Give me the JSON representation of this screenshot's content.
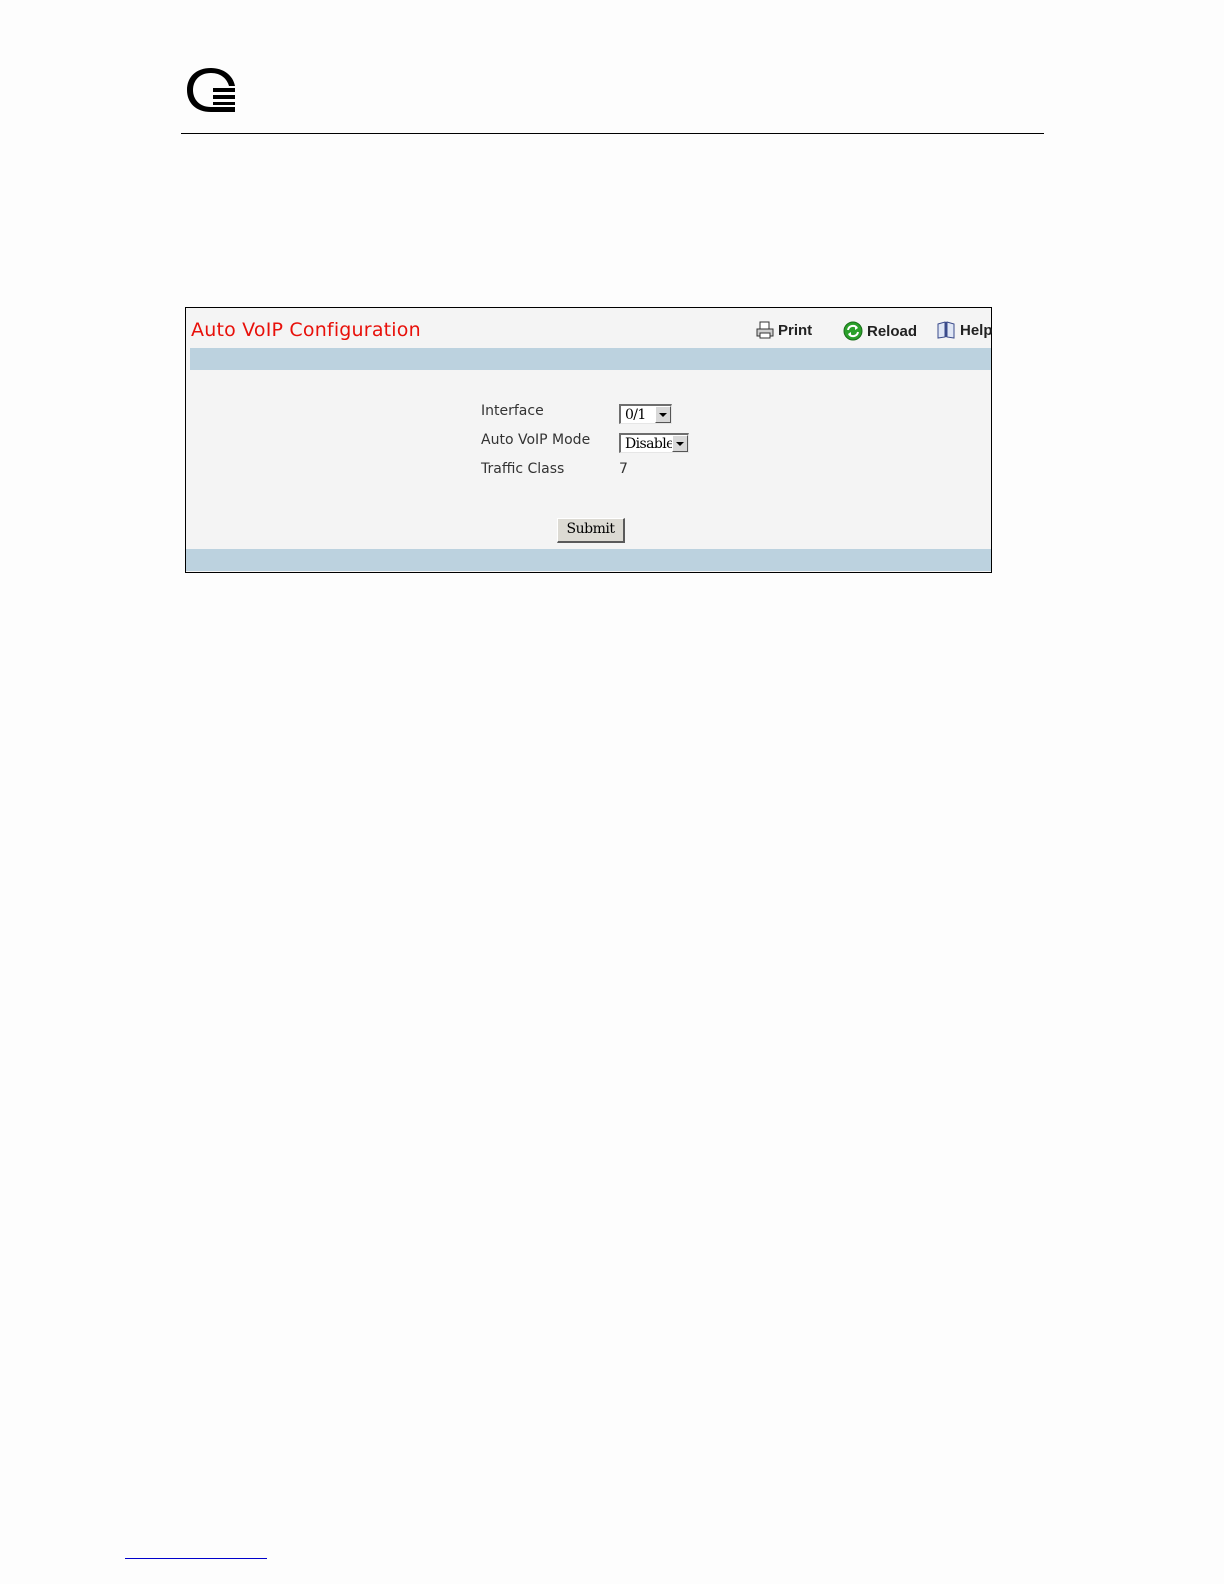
{
  "page": {
    "logo_icon": "qlogic-logo-icon"
  },
  "panel": {
    "title": "Auto VoIP Configuration",
    "title_color": "#e8100a",
    "band_color": "#bcd2df",
    "toolbar": {
      "print_label": "Print",
      "print_icon": "printer-icon",
      "reload_label": "Reload",
      "reload_icon": "reload-icon",
      "help_label": "Help",
      "help_icon": "book-icon"
    },
    "form": {
      "interface_label": "Interface",
      "interface_value": "0/1",
      "mode_label": "Auto VoIP Mode",
      "mode_value": "Disable",
      "traffic_class_label": "Traffic Class",
      "traffic_class_value": "7"
    },
    "submit_label": "Submit"
  }
}
